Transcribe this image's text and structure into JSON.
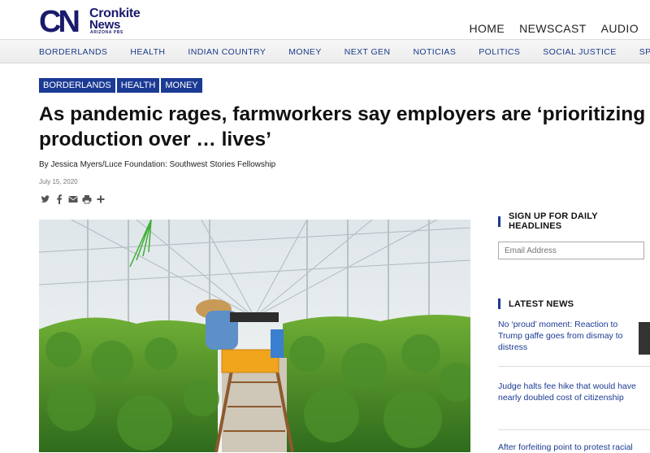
{
  "logo": {
    "cn": "CN",
    "word1": "Cronkite",
    "word2": "News",
    "sub": "ARIZONA PBS"
  },
  "top_nav": [
    "HOME",
    "NEWSCAST",
    "AUDIO"
  ],
  "section_nav": [
    "BORDERLANDS",
    "HEALTH",
    "INDIAN COUNTRY",
    "MONEY",
    "NEXT GEN",
    "NOTICIAS",
    "POLITICS",
    "SOCIAL JUSTICE",
    "SPORT",
    "S"
  ],
  "article": {
    "tags": [
      "BORDERLANDS",
      "HEALTH",
      "MONEY"
    ],
    "title": "As pandemic rages, farmworkers say employers are ‘prioritizing production over … lives’",
    "byline": "By Jessica Myers/Luce Foundation: Southwest Stories Fellowship",
    "date": "July 15, 2020",
    "share_icons": [
      "twitter-icon",
      "facebook-icon",
      "email-icon",
      "print-icon",
      "plus-icon"
    ]
  },
  "sidebar": {
    "signup_title": "SIGN UP FOR DAILY HEADLINES",
    "email_placeholder": "Email Address",
    "latest_title": "LATEST NEWS",
    "latest": [
      "No ‘proud’ moment: Reaction to Trump gaffe goes from dismay to distress",
      "Judge halts fee hike that would have nearly doubled cost of citizenship",
      "After forfeiting point to protest racial"
    ]
  },
  "colors": {
    "brand_blue": "#1b3a94",
    "link_blue": "#1b3a94"
  }
}
